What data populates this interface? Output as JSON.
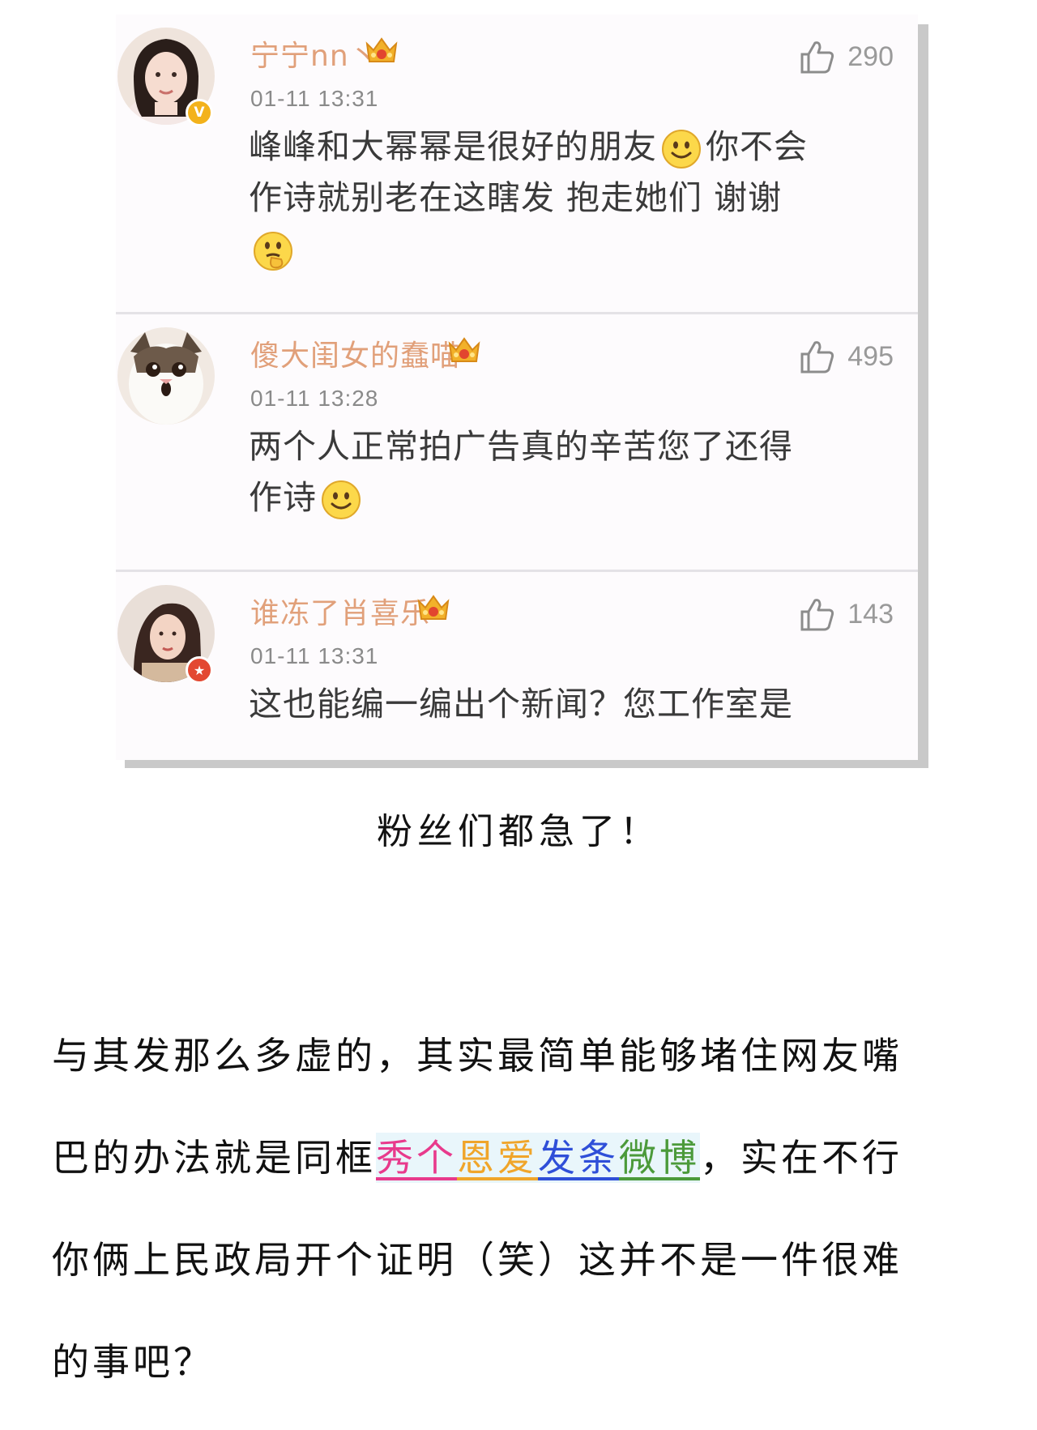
{
  "comments": [
    {
      "username": "宁宁nn丶",
      "timestamp": "01-11 13:31",
      "likes": "290",
      "text_parts": [
        "峰峰和大幂幂是很好的朋友",
        "你不会作诗就别老在这瞎发 抱走她们 谢谢"
      ],
      "badge": "V",
      "badge_color": "#f3b21b",
      "emojis": [
        "smile-emoji",
        "thinking-emoji"
      ]
    },
    {
      "username": "傻大闺女的蠢喵",
      "timestamp": "01-11 13:28",
      "likes": "495",
      "text_parts": [
        "两个人正常拍广告真的辛苦您了还得作诗",
        ""
      ],
      "emojis": [
        "smile-emoji"
      ]
    },
    {
      "username": "谁冻了肖喜乐",
      "timestamp": "01-11 13:31",
      "likes": "143",
      "text_parts": [
        "这也能编一编出个新闻？您工作室是",
        ""
      ],
      "badge": "★",
      "badge_color": "#e34832",
      "emojis": []
    }
  ],
  "caption": "粉丝们都急了！",
  "article": {
    "line1": "与其发那么多虚的，其实最简单能够堵住网友嘴",
    "line2_before": "巴的办法就是同框",
    "highlight": [
      {
        "text": "秀个",
        "color": "#e83a8c"
      },
      {
        "text": "恩爱",
        "color": "#f0a52a"
      },
      {
        "text": "发条",
        "color": "#2f4fd8"
      },
      {
        "text": "微博",
        "color": "#4b9a3a"
      }
    ],
    "line2_after": "，实在不行",
    "line3": "你俩上民政局开个证明（笑）这并不是一件很难",
    "line4": "的事吧？"
  },
  "icons": {
    "like": "thumbs-up-icon",
    "vip": "crown-vip-icon"
  },
  "colors": {
    "username": "#e1a07a",
    "timestamp": "#8a8a8a",
    "comment_text": "#3a3a3a",
    "vip_gold": "#f2b12a",
    "highlight_bg": "#e9f6fb"
  }
}
